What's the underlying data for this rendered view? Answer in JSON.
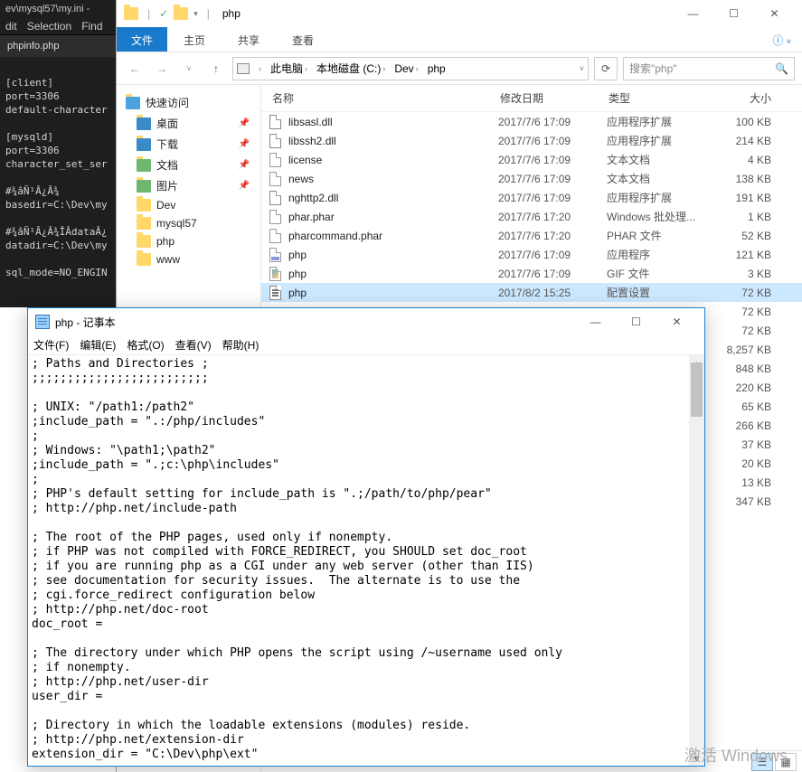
{
  "editor": {
    "title": "ev\\mysql57\\my.ini -",
    "menu": [
      "dit",
      "Selection",
      "Find"
    ],
    "tab": "phpinfo.php",
    "content": "\n[client]\nport=3306\ndefault-character\n\n[mysqld]\nport=3306\ncharacter_set_ser\n\n#¾âÑ¹Â¿Â¾\nbasedir=C:\\Dev\\my\n\n#¾âÑ¹Â¿Â¾ÎÂdataÂ¿\ndatadir=C:\\Dev\\my\n\nsql_mode=NO_ENGIN"
  },
  "explorer": {
    "qat": {
      "title": "php"
    },
    "winbtns": {
      "min": "—",
      "max": "☐",
      "close": "✕"
    },
    "ribbon": {
      "file": "文件",
      "tabs": [
        "主页",
        "共享",
        "查看"
      ],
      "help": "?"
    },
    "nav": {
      "back": "←",
      "fwd": "→",
      "up": "↑",
      "down": "˅"
    },
    "breadcrumb": [
      "此电脑",
      "本地磁盘 (C:)",
      "Dev",
      "php"
    ],
    "refresh": "⟳",
    "search": {
      "placeholder": "搜索\"php\"",
      "icon": "🔍"
    },
    "sidebar": {
      "quick": "快速访问",
      "items": [
        {
          "label": "桌面",
          "pin": true
        },
        {
          "label": "下载",
          "pin": true
        },
        {
          "label": "文档",
          "pin": true
        },
        {
          "label": "图片",
          "pin": true
        },
        {
          "label": "Dev",
          "pin": false
        },
        {
          "label": "mysql57",
          "pin": false
        },
        {
          "label": "php",
          "pin": false
        },
        {
          "label": "www",
          "pin": false
        }
      ]
    },
    "columns": {
      "name": "名称",
      "date": "修改日期",
      "type": "类型",
      "size": "大小"
    },
    "files": [
      {
        "name": "libsasl.dll",
        "date": "2017/7/6 17:09",
        "type": "应用程序扩展",
        "size": "100 KB",
        "ico": "dll"
      },
      {
        "name": "libssh2.dll",
        "date": "2017/7/6 17:09",
        "type": "应用程序扩展",
        "size": "214 KB",
        "ico": "dll"
      },
      {
        "name": "license",
        "date": "2017/7/6 17:09",
        "type": "文本文档",
        "size": "4 KB",
        "ico": "txt"
      },
      {
        "name": "news",
        "date": "2017/7/6 17:09",
        "type": "文本文档",
        "size": "138 KB",
        "ico": "txt"
      },
      {
        "name": "nghttp2.dll",
        "date": "2017/7/6 17:09",
        "type": "应用程序扩展",
        "size": "191 KB",
        "ico": "dll"
      },
      {
        "name": "phar.phar",
        "date": "2017/7/6 17:20",
        "type": "Windows 批处理...",
        "size": "1 KB",
        "ico": "txt"
      },
      {
        "name": "pharcommand.phar",
        "date": "2017/7/6 17:20",
        "type": "PHAR 文件",
        "size": "52 KB",
        "ico": "txt"
      },
      {
        "name": "php",
        "date": "2017/7/6 17:09",
        "type": "应用程序",
        "size": "121 KB",
        "ico": "exe"
      },
      {
        "name": "php",
        "date": "2017/7/6 17:09",
        "type": "GIF 文件",
        "size": "3 KB",
        "ico": "gif"
      },
      {
        "name": "php",
        "date": "2017/8/2 15:25",
        "type": "配置设置",
        "size": "72 KB",
        "ico": "ini",
        "sel": true
      }
    ],
    "extra_sizes": [
      "72 KB",
      "72 KB",
      "8,257 KB",
      "848 KB",
      "220 KB",
      "65 KB",
      "266 KB",
      "37 KB",
      "20 KB",
      "13 KB",
      "347 KB"
    ]
  },
  "notepad": {
    "title": "php - 记事本",
    "menu": [
      "文件(F)",
      "编辑(E)",
      "格式(O)",
      "查看(V)",
      "帮助(H)"
    ],
    "winbtns": {
      "min": "—",
      "max": "☐",
      "close": "✕"
    },
    "content": "; Paths and Directories ;\n;;;;;;;;;;;;;;;;;;;;;;;;;\n\n; UNIX: \"/path1:/path2\"\n;include_path = \".:/php/includes\"\n;\n; Windows: \"\\path1;\\path2\"\n;include_path = \".;c:\\php\\includes\"\n;\n; PHP's default setting for include_path is \".;/path/to/php/pear\"\n; http://php.net/include-path\n\n; The root of the PHP pages, used only if nonempty.\n; if PHP was not compiled with FORCE_REDIRECT, you SHOULD set doc_root\n; if you are running php as a CGI under any web server (other than IIS)\n; see documentation for security issues.  The alternate is to use the\n; cgi.force_redirect configuration below\n; http://php.net/doc-root\ndoc_root =\n\n; The directory under which PHP opens the script using /~username used only\n; if nonempty.\n; http://php.net/user-dir\nuser_dir =\n\n; Directory in which the loadable extensions (modules) reside.\n; http://php.net/extension-dir\nextension_dir = \"C:\\Dev\\php\\ext\""
  },
  "watermark": "激活 Windows"
}
